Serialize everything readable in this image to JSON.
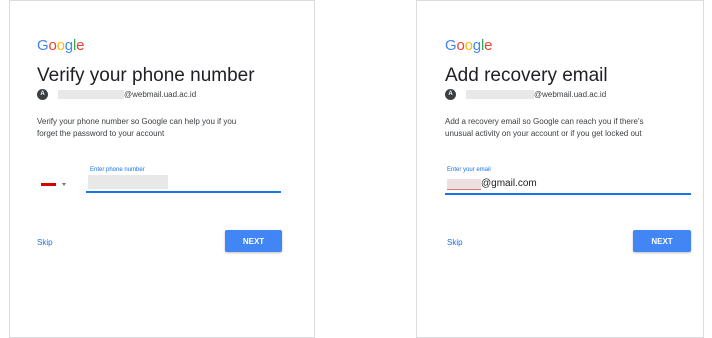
{
  "logo_text": {
    "b": "G",
    "r": "o",
    "y": "o",
    "b2": "g",
    "g": "l",
    "r2": "e"
  },
  "colors": {
    "blue": "#4285f4",
    "red": "#ea4335",
    "yellow": "#fbbc05",
    "green": "#34a853",
    "link": "#1a73e8"
  },
  "left": {
    "title": "Verify your phone number",
    "avatar_letter": "A",
    "account_email": "@webmail.uad.ac.id",
    "description": "Verify your phone number so Google can help you if you\nforget the password to your account",
    "field_label": "Enter phone number",
    "country_flag_icon": "flag-icon",
    "skip_label": "Skip",
    "next_label": "NEXT"
  },
  "right": {
    "title": "Add recovery email",
    "avatar_letter": "A",
    "account_email": "@webmail.uad.ac.id",
    "description": "Add a recovery email so Google can reach you if there's\nunusual activity on your account or if you get locked out",
    "field_label": "Enter your email",
    "email_value": "@gmail.com",
    "skip_label": "Skip",
    "next_label": "NEXT"
  }
}
